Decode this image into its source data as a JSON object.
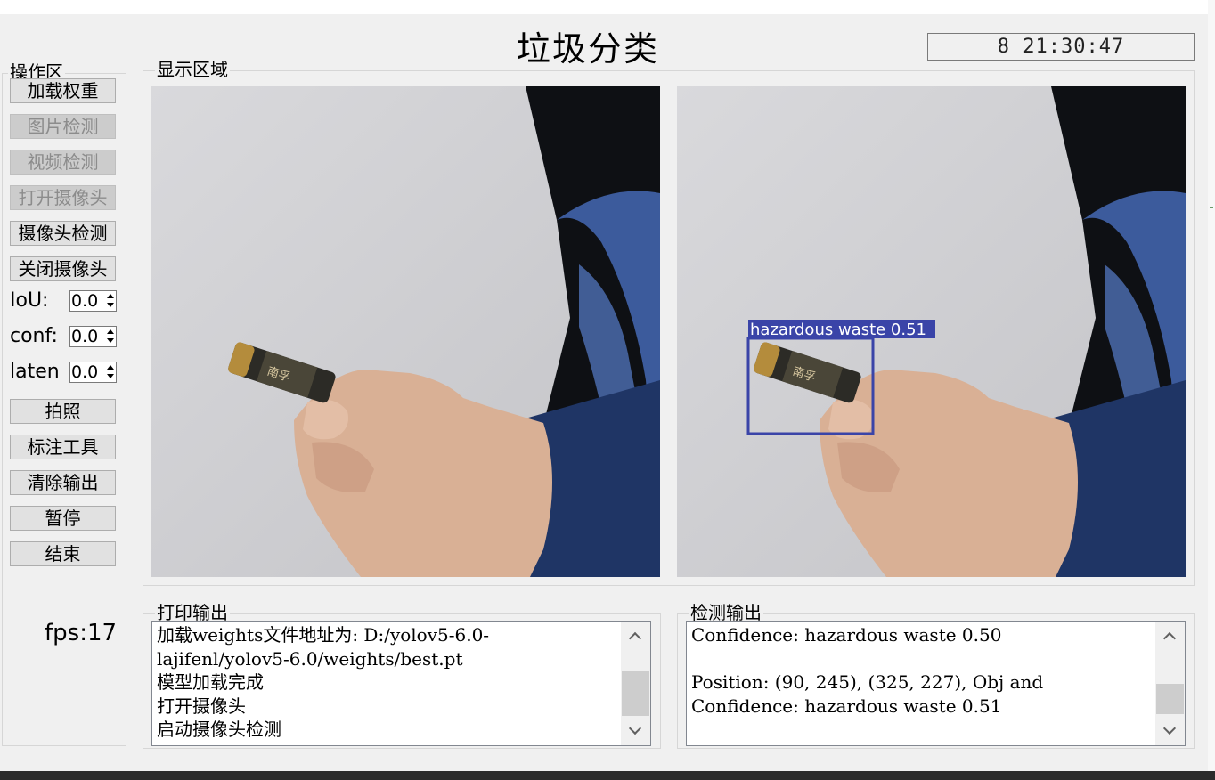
{
  "window": {
    "title": "垃圾分类",
    "clock": "8 21:30:47"
  },
  "groups": {
    "operations": "操作区",
    "display": "显示区域",
    "print_output": "打印输出",
    "detect_output": "检测输出"
  },
  "buttons": [
    {
      "label": "加载权重",
      "enabled": true
    },
    {
      "label": "图片检测",
      "enabled": false
    },
    {
      "label": "视频检测",
      "enabled": false
    },
    {
      "label": "打开摄像头",
      "enabled": false
    },
    {
      "label": "摄像头检测",
      "enabled": true
    },
    {
      "label": "关闭摄像头",
      "enabled": true
    }
  ],
  "params": [
    {
      "label": "IoU:",
      "value": "0.0"
    },
    {
      "label": "conf:",
      "value": "0.0"
    },
    {
      "label": "laten",
      "value": "0.0"
    }
  ],
  "actions": [
    {
      "label": "拍照"
    },
    {
      "label": "标注工具"
    },
    {
      "label": "清除输出"
    },
    {
      "label": "暂停"
    },
    {
      "label": "结束"
    }
  ],
  "fps": "fps:17",
  "detection": {
    "label": "hazardous waste 0.51",
    "box_color": "#3a44a8"
  },
  "print_log": [
    "加载weights文件地址为: D:/yolov5-6.0-",
    "lajifenl/yolov5-6.0/weights/best.pt",
    "模型加载完成",
    "打开摄像头",
    "启动摄像头检测"
  ],
  "detect_log": [
    "Confidence: hazardous waste 0.50",
    "",
    "Position: (90, 245), (325, 227), Obj and",
    "Confidence: hazardous waste 0.51"
  ]
}
